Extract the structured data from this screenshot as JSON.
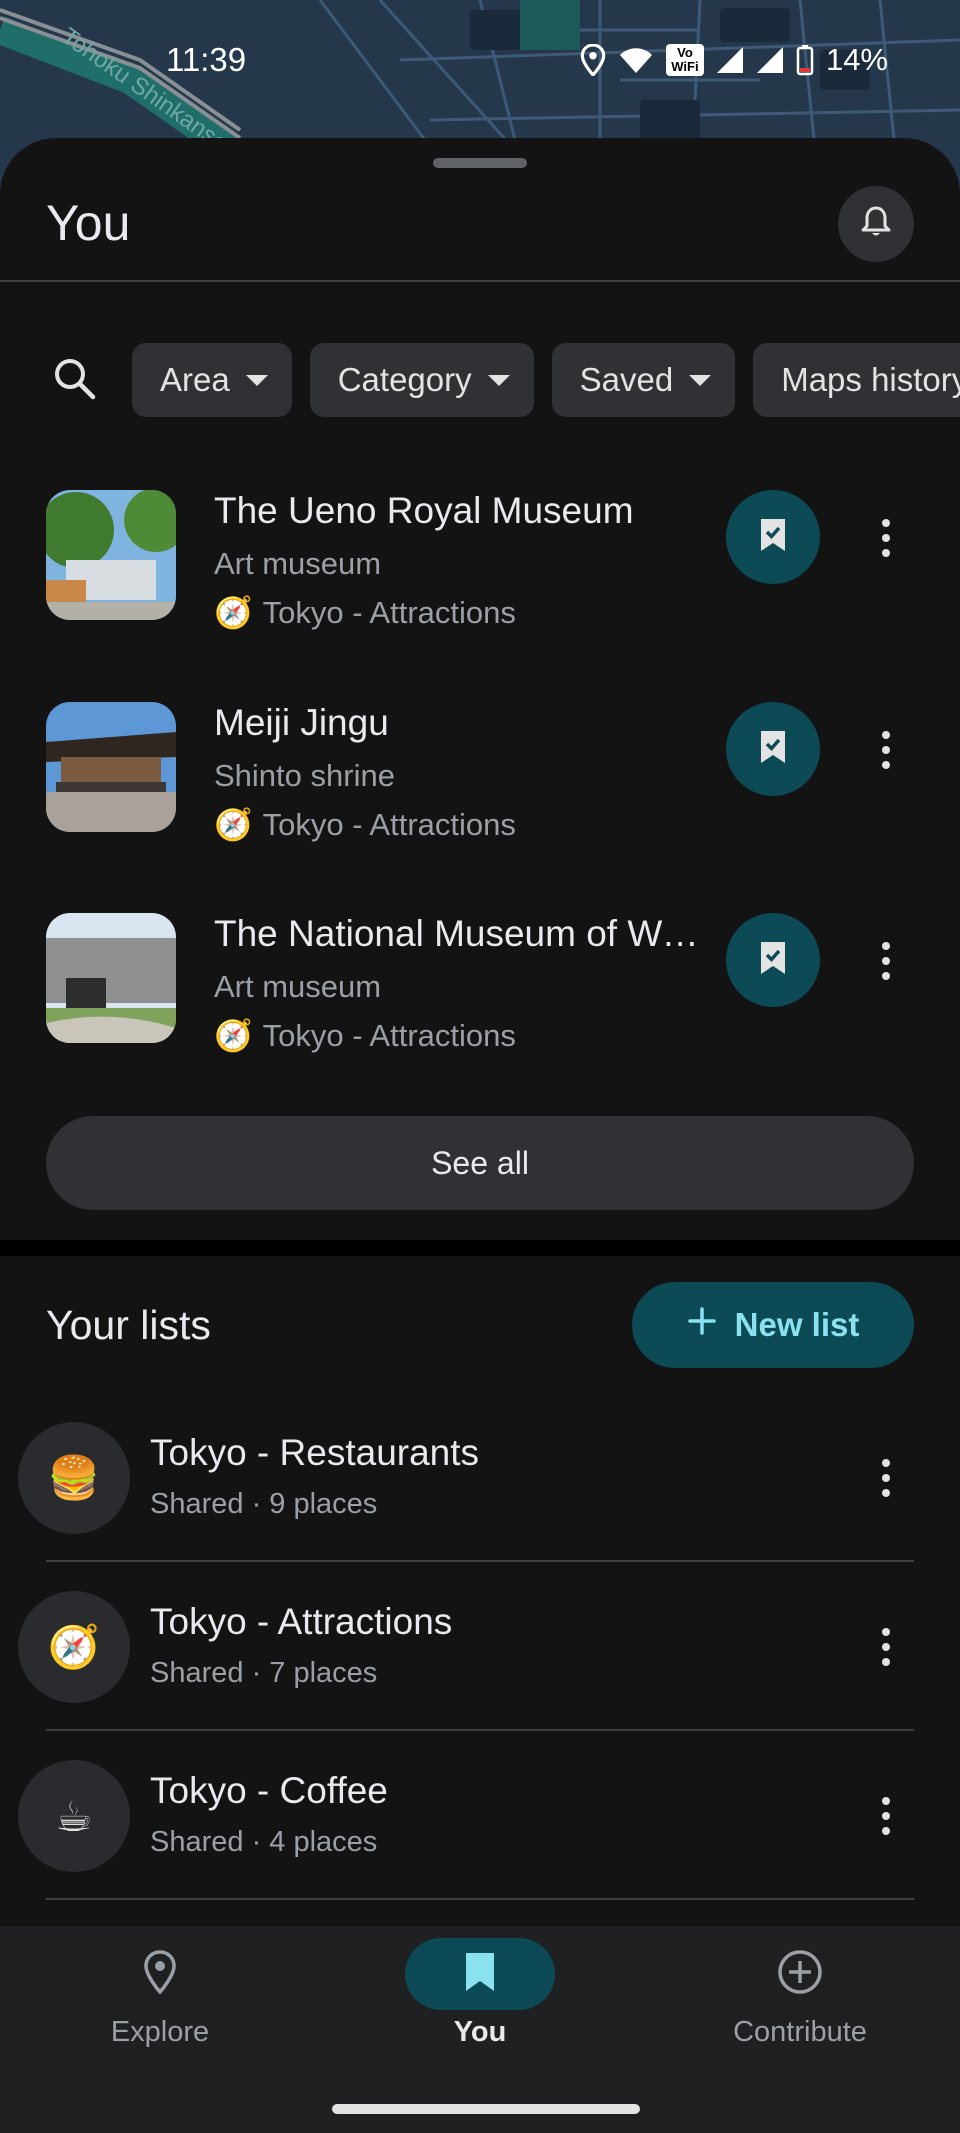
{
  "status_bar": {
    "time": "11:39",
    "battery": "14%",
    "wifi_badge": "Vo WiFi"
  },
  "map": {
    "label": "Tohoku Shinkansen"
  },
  "header": {
    "title": "You"
  },
  "filters": [
    {
      "label": "Area"
    },
    {
      "label": "Category"
    },
    {
      "label": "Saved"
    },
    {
      "label": "Maps history"
    }
  ],
  "places": [
    {
      "name": "The Ueno Royal Museum",
      "category": "Art museum",
      "list": "Tokyo - Attractions"
    },
    {
      "name": "Meiji Jingu",
      "category": "Shinto shrine",
      "list": "Tokyo - Attractions"
    },
    {
      "name": "The National Museum of Western Art",
      "category": "Art museum",
      "list": "Tokyo - Attractions"
    }
  ],
  "see_all_label": "See all",
  "lists_section": {
    "title": "Your lists",
    "new_list_label": "New list",
    "items": [
      {
        "name": "Tokyo - Restaurants",
        "meta": "Shared · 9 places",
        "emoji": "🍔"
      },
      {
        "name": "Tokyo - Attractions",
        "meta": "Shared · 7 places",
        "emoji": "🧭"
      },
      {
        "name": "Tokyo - Coffee",
        "meta": "Shared · 4 places",
        "emoji": "☕"
      }
    ]
  },
  "nav": {
    "explore": "Explore",
    "you": "You",
    "contribute": "Contribute"
  },
  "colors": {
    "background": "#131314",
    "accent_container": "#0c4a55",
    "accent_text": "#8ae2f0",
    "chip": "#303134"
  }
}
